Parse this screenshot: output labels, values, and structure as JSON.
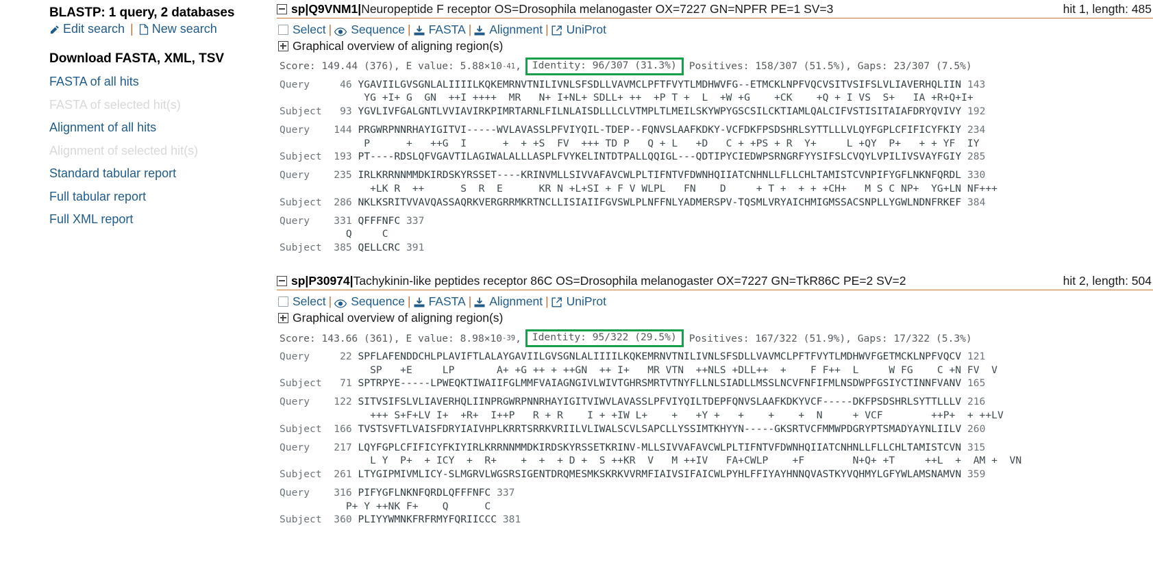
{
  "sidebar": {
    "title": "BLASTP: 1 query, 2 databases",
    "edit_search": "Edit search",
    "new_search": "New search",
    "separator": "|",
    "download_title": "Download FASTA, XML, TSV",
    "links": [
      {
        "label": "FASTA of all hits",
        "disabled": false
      },
      {
        "label": "FASTA of selected hit(s)",
        "disabled": true
      },
      {
        "label": "Alignment of all hits",
        "disabled": false
      },
      {
        "label": "Alignment of selected hit(s)",
        "disabled": true
      },
      {
        "label": "Standard tabular report",
        "disabled": false
      },
      {
        "label": "Full tabular report",
        "disabled": false
      },
      {
        "label": "Full XML report",
        "disabled": false
      }
    ],
    "icons": {
      "edit": "pencil-icon",
      "new": "document-icon"
    }
  },
  "tools": {
    "select": "Select",
    "sequence": "Sequence",
    "fasta": "FASTA",
    "alignment": "Alignment",
    "uniprot": "UniProt",
    "graphical_overview": "Graphical overview of aligning region(s)",
    "separator": "|"
  },
  "colors": {
    "link": "#1f5c8b",
    "rule": "#c4762f",
    "identity_highlight": "#17a04a",
    "disabled": "#d9d9d9",
    "mono_text": "#3d4a4f"
  },
  "hits": [
    {
      "accession": "sp|Q9VNM1|",
      "description": " Neuropeptide F receptor OS=Drosophila melanogaster OX=7227 GN=NPFR PE=1 SV=3",
      "meta": "hit 1, length: 485",
      "stats": {
        "score": "Score: 149.44 (376), E value: 5.88×10",
        "evalue_exp": "-41",
        "after_exp": ",",
        "identity": "Identity: 96/307 (31.3%)",
        "rest": "Positives: 158/307 (51.5%), Gaps: 23/307 (7.5%)"
      },
      "blocks": [
        {
          "query_label": "Query",
          "query_start": "46",
          "query_seq": "YGAVIILGVSGNLALIIIILKQKEMRNVTNILIVNLSFSDLLVAVMCLPFTFVYTLMDHWVFG--ETMCKLNPFVQCVSITVSIFSLVLIAVERHQLIIN",
          "query_end": "143",
          "midline": "  YG +I+ G  GN  ++I ++++  MR   N+ I+NL+ SDLL+ ++  +P T +  L  +W +G    +CK    +Q + I VS  S+   IA +R+Q+I+",
          "subject_label": "Subject",
          "subject_start": "93",
          "subject_seq": "YGVLIVFGALGNTLVVIAVIRKPIMRTARNLFILNLAISDLLLCLVTMPLTLMEILSKYWPYGSCSILCKTIAMLQALCIFVSTISITAIAFDRYQVIVY",
          "subject_end": "192"
        },
        {
          "query_label": "Query",
          "query_start": "144",
          "query_seq": "PRGWRPNNRHAYIGITVI-----WVLAVASSLPFVIYQIL-TDEP--FQNVSLAAFKDKY-VCFDKFPSDSHRLSYTTLLLVLQYFGPLCFIFICYFKIY",
          "query_end": "234",
          "midline": "  P      +   ++G  I      +  + +S  FV  +++ TD P   Q + L   +D   C + +PS + R  Y+     L +QY  P+   + + YF  IY",
          "subject_label": "Subject",
          "subject_start": "193",
          "subject_seq": "PT----RDSLQFVGAVTILAGIWALALLLASPLFVYKELINTDTPALLQQIGL---QDTIPYCIEDWPSRNGRFYYSIFSLCVQYLVPILIVSVAYFGIY",
          "subject_end": "285"
        },
        {
          "query_label": "Query",
          "query_start": "235",
          "query_seq": "IRLKRRNNMMDKIRDSKYRSSET----KRINVMLLSIVVAFAVCWLPLTIFNTVFDWNHQIIATCNHNLLFLLCHLTAMISTCVNPIFYGFLNKNFQRDL",
          "query_end": "330",
          "midline": "   +LK R  ++      S  R  E      KR N +L+SI + F V WLPL   FN    D     + T +  + + +CH+   M S C NP+  YG+LN NF+++",
          "subject_label": "Subject",
          "subject_start": "286",
          "subject_seq": "NKLKSRITVVAVQASSAQRKVERGRRMKRTNCLLISIAIIFGVSWLPLNFFNLYADMERSPV-TQSMLVRYAICHMIGMSSACSNPLLYGWLNDNFRKEF",
          "subject_end": "384"
        },
        {
          "query_label": "Query",
          "query_start": "331",
          "query_seq": "QFFFNFC",
          "query_end": "337",
          "midline": "         Q     C",
          "subject_label": "Subject",
          "subject_start": "385",
          "subject_seq": "QELLCRC",
          "subject_end": "391"
        }
      ]
    },
    {
      "accession": "sp|P30974|",
      "description": " Tachykinin-like peptides receptor 86C OS=Drosophila melanogaster OX=7227 GN=TkR86C PE=2 SV=2",
      "meta": "hit 2, length: 504",
      "stats": {
        "score": "Score: 143.66 (361), E value: 8.98×10",
        "evalue_exp": "-39",
        "after_exp": ",",
        "identity": "Identity: 95/322 (29.5%)",
        "rest": "Positives: 167/322 (51.9%), Gaps: 17/322 (5.3%)"
      },
      "blocks": [
        {
          "query_label": "Query",
          "query_start": "22",
          "query_seq": "SPFLAFENDDCHLPLAVIFTLALAYGAVIILGVSGNLALIIIILKQKEMRNVTNILIVNLSFSDLLVAVMCLPFTFVYTLMDHWVFGETMCKLNPFVQCV",
          "query_end": "121",
          "midline": "   SP   +E     LP       A+ +G ++ + ++GN  ++ I+   MR VTN  ++NLS +DLL++  +    F F++  L     W FG    C +N FV  V",
          "subject_label": "Subject",
          "subject_start": "71",
          "subject_seq": "SPTRPYE-----LPWEQKTIWAIIFGLMMFVAIAGNGIVLWIVTGHRSMRTVTNYFLLNLSIADLLMSSLNCVFNFIFMLNSDWPFGSIYCTINNFVANV",
          "subject_end": "165"
        },
        {
          "query_label": "Query",
          "query_start": "122",
          "query_seq": "SITVSIFSLVLIAVERHQLIINPRGWRPNNRHAYIGITVIWVLAVASSLPFVIYQILTDEPFQNVSLAAFKDKYVCF-----DKFPSDSHRLSYTTLLLV",
          "query_end": "216",
          "midline": "   +++ S+F+LV I+  +R+  I++P   R + R    I + +IW L+    +   +Y +   +    +    +  N     + VCF        ++P+  + ++LV",
          "subject_label": "Subject",
          "subject_start": "166",
          "subject_seq": "TVSTSVFTLVAISFDRYIAIVHPLKRRTSRRKVRIILVLIWALSCVLSAPCLLYSSIMTKHYYN-----GKSRTVCFMMWPDGRYPTSMADYAYNLIILV",
          "subject_end": "260"
        },
        {
          "query_label": "Query",
          "query_start": "217",
          "query_seq": "LQYFGPLCFIFICYFKIYIRLKRRNNMMDKIRDSKYRSSETKRINV-MLLSIVVAFAVCWLPLTIFNTVFDWNHQIIATCNHNLLFLLCHLTAMISTCVN",
          "query_end": "315",
          "midline": "   L Y  P+  + ICY  +  R+    +  +  + D +  S ++KR  V   M ++IV   FA+CWLP    +F        N+Q+ +T     ++L  +  AM +  VN",
          "subject_label": "Subject",
          "subject_start": "261",
          "subject_seq": "LTYGIPMIVMLICY-SLMGRVLWGSRSIGENTDRQMESMKSKRKVVRMFIAIVSIFAICWLPYHLFFIYAYHNNQVASTKYVQHMYLGFYWLAMSNAMVN",
          "subject_end": "359"
        },
        {
          "query_label": "Query",
          "query_start": "316",
          "query_seq": "PIFYGFLNKNFQRDLQFFFNFC",
          "query_end": "337",
          "midline": "         P+ Y ++NK F+    Q      C",
          "subject_label": "Subject",
          "subject_start": "360",
          "subject_seq": "PLIYYWMNKFRFRMYFQRIICCC",
          "subject_end": "381"
        }
      ]
    }
  ]
}
